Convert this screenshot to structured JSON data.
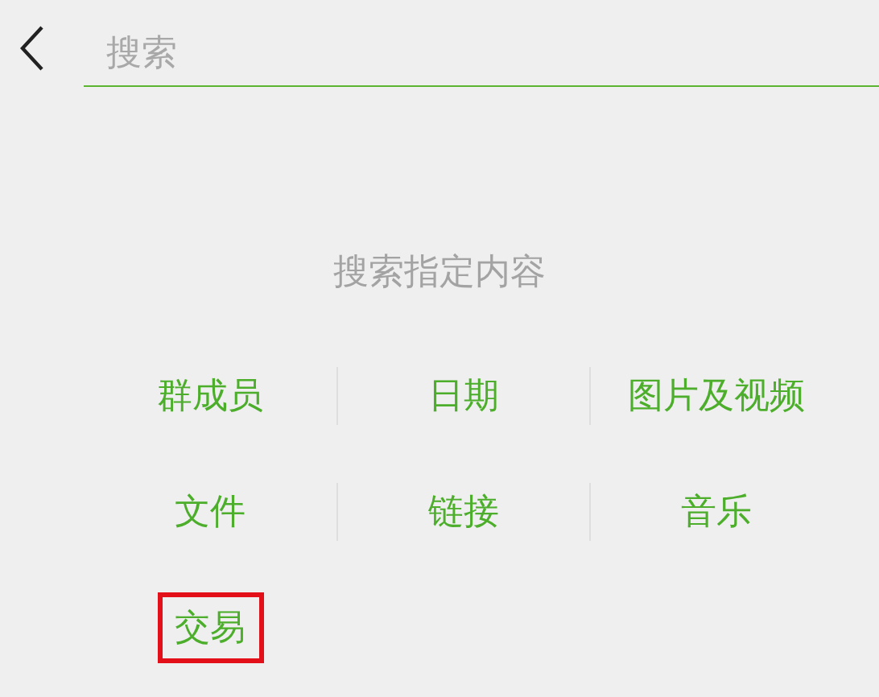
{
  "search": {
    "placeholder": "搜索"
  },
  "heading": "搜索指定内容",
  "options": [
    {
      "label": "群成员",
      "highlighted": false
    },
    {
      "label": "日期",
      "highlighted": false
    },
    {
      "label": "图片及视频",
      "highlighted": false
    },
    {
      "label": "文件",
      "highlighted": false
    },
    {
      "label": "链接",
      "highlighted": false
    },
    {
      "label": "音乐",
      "highlighted": false
    },
    {
      "label": "交易",
      "highlighted": true
    }
  ]
}
